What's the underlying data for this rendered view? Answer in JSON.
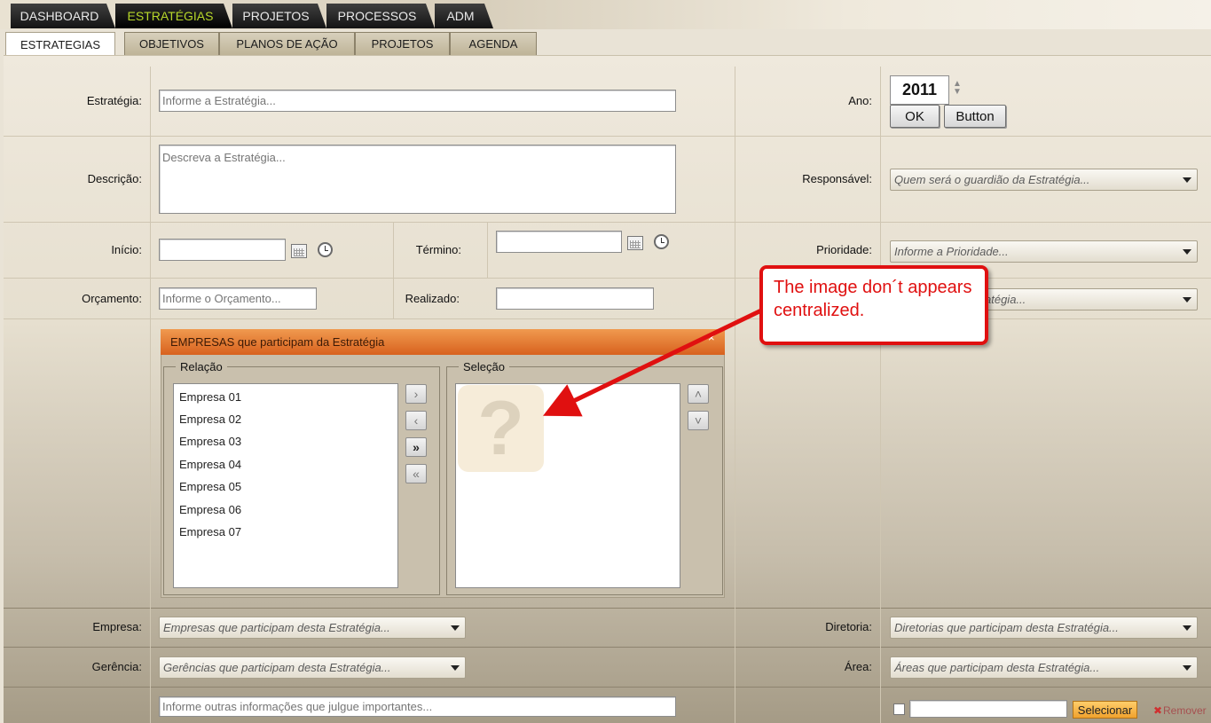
{
  "nav": {
    "main_tabs": [
      "DASHBOARD",
      "ESTRATÉGIAS",
      "PROJETOS",
      "PROCESSOS",
      "ADM"
    ],
    "sub_tabs": [
      "ESTRATEGIAS",
      "OBJETIVOS",
      "PLANOS DE AÇÃO",
      "PROJETOS",
      "AGENDA"
    ]
  },
  "form": {
    "estrategia_label": "Estratégia:",
    "estrategia_placeholder": "Informe a Estratégia...",
    "descricao_label": "Descrição:",
    "descricao_placeholder": "Descreva a Estratégia...",
    "inicio_label": "Início:",
    "termino_label": "Término:",
    "orcamento_label": "Orçamento:",
    "orcamento_placeholder": "Informe o Orçamento...",
    "realizado_label": "Realizado:",
    "ano_label": "Ano:",
    "ano_value": "2011",
    "ok_label": "OK",
    "button_label": "Button",
    "responsavel_label": "Responsável:",
    "responsavel_placeholder": "Quem será o guardião da Estratégia...",
    "prioridade_label": "Prioridade:",
    "prioridade_placeholder": "Informe a Prioridade...",
    "hidden_combo_text": "atégia...",
    "empresa_label": "Empresa:",
    "empresa_placeholder": "Empresas que participam desta Estratégia...",
    "gerencia_label": "Gerência:",
    "gerencia_placeholder": "Gerências que participam desta Estratégia...",
    "diretoria_label": "Diretoria:",
    "diretoria_placeholder": "Diretorias que participam desta Estratégia...",
    "area_label": "Área:",
    "area_placeholder": "Áreas que participam desta Estratégia...",
    "outras_placeholder": "Informe outras informações que julgue importantes...",
    "selecionar_label": "Selecionar",
    "remover_label": "Remover"
  },
  "empresas_panel": {
    "title": "EMPRESAS que participam da Estratégia",
    "close_glyph": "×",
    "relacao_label": "Relação",
    "selecao_label": "Seleção",
    "relacao_items": [
      "Empresa 01",
      "Empresa 02",
      "Empresa 03",
      "Empresa 04",
      "Empresa 05",
      "Empresa 06",
      "Empresa 07"
    ],
    "move_right": "›",
    "move_left": "‹",
    "move_all_right": "»",
    "move_all_left": "«",
    "move_up": "˄",
    "move_down": "˅",
    "placeholder_glyph": "?"
  },
  "annotation": {
    "text": "The image don´t appears centralized.",
    "color": "#e01010"
  },
  "colors": {
    "active_tab_text": "#b7d72a",
    "panel_header": "#e0732e"
  }
}
